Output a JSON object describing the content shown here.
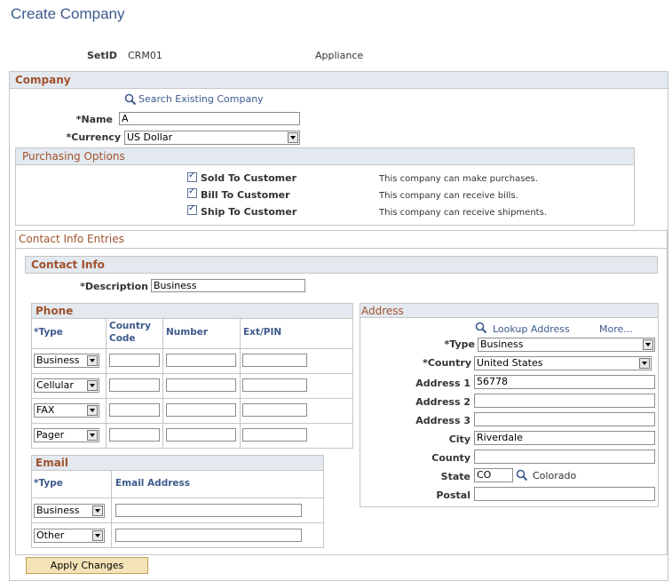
{
  "page": {
    "title": "Create Company"
  },
  "setid": {
    "label": "SetID",
    "value": "CRM01",
    "description": "Appliance"
  },
  "company": {
    "header": "Company",
    "search_link": "Search Existing Company",
    "name_label": "*Name",
    "name_value": "A",
    "currency_label": "*Currency",
    "currency_value": "US Dollar"
  },
  "purchasing": {
    "header": "Purchasing Options",
    "options": [
      {
        "label": "Sold To Customer",
        "desc": "This company can make purchases.",
        "checked": true
      },
      {
        "label": "Bill To Customer",
        "desc": "This company can receive bills.",
        "checked": true
      },
      {
        "label": "Ship To Customer",
        "desc": "This company can receive shipments.",
        "checked": true
      }
    ]
  },
  "contact_entries": {
    "header": "Contact Info Entries"
  },
  "contact_info": {
    "header": "Contact Info",
    "description_label": "*Description",
    "description_value": "Business"
  },
  "phone": {
    "header": "Phone",
    "columns": {
      "type": "*Type",
      "country_line1": "Country",
      "country_line2": "Code",
      "number": "Number",
      "ext": "Ext/PIN"
    },
    "rows": [
      {
        "type": "Business"
      },
      {
        "type": "Cellular"
      },
      {
        "type": "FAX"
      },
      {
        "type": "Pager"
      }
    ]
  },
  "email": {
    "header": "Email",
    "columns": {
      "type": "*Type",
      "address": "Email Address"
    },
    "rows": [
      {
        "type": "Business"
      },
      {
        "type": "Other"
      }
    ]
  },
  "address": {
    "header": "Address",
    "lookup_link": "Lookup Address",
    "more_link": "More...",
    "type_label": "*Type",
    "type_value": "Business",
    "country_label": "*Country",
    "country_value": "United States",
    "address1_label": "Address 1",
    "address1_value": "56778",
    "address2_label": "Address 2",
    "address3_label": "Address 3",
    "city_label": "City",
    "city_value": "Riverdale",
    "county_label": "County",
    "state_label": "State",
    "state_value": "CO",
    "state_desc": "Colorado",
    "postal_label": "Postal"
  },
  "actions": {
    "apply_label": "Apply Changes"
  },
  "icons": {
    "search": "search-icon",
    "dropdown": "chevron-down-icon",
    "checkbox": "checkmark-icon"
  }
}
